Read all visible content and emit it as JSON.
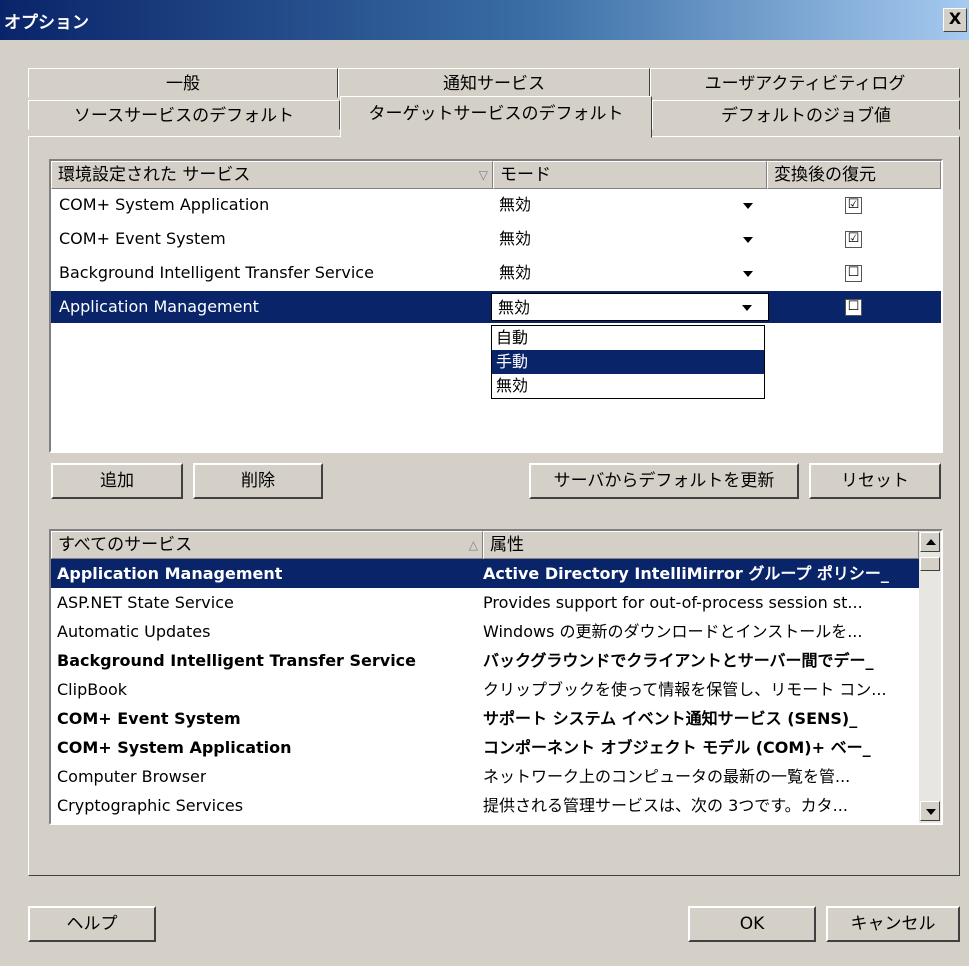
{
  "window": {
    "title": "オプション",
    "close_label": "X"
  },
  "tabs_row1": [
    "一般",
    "通知サービス",
    "ユーザアクティビティログ"
  ],
  "tabs_row2": [
    "ソースサービスのデフォルト",
    "ターゲットサービスのデフォルト",
    "デフォルトのジョブ値"
  ],
  "configured": {
    "headers": {
      "service": "環境設定された サービス",
      "mode": "モード",
      "restore": "変換後の復元"
    },
    "rows": [
      {
        "service": "COM+ System Application",
        "mode": "無効",
        "restore": "☑"
      },
      {
        "service": "COM+ Event System",
        "mode": "無効",
        "restore": "☑"
      },
      {
        "service": "Background Intelligent Transfer Service",
        "mode": "無効",
        "restore": "☐"
      },
      {
        "service": "Application Management",
        "mode": "無効",
        "restore": "☐"
      }
    ],
    "dropdown_options": [
      "自動",
      "手動",
      "無効"
    ],
    "dropdown_selected": "手動"
  },
  "buttons": {
    "add": "追加",
    "delete": "削除",
    "update_from_server": "サーバからデフォルトを更新",
    "reset": "リセット",
    "help": "ヘルプ",
    "ok": "OK",
    "cancel": "キャンセル"
  },
  "all_services": {
    "headers": {
      "service": "すべてのサービス",
      "attr": "属性"
    },
    "rows": [
      {
        "name": "Application Management",
        "attr": "Active Directory IntelliMirror グループ ポリシー_",
        "bold": true
      },
      {
        "name": "ASP.NET State Service",
        "attr": "Provides support for out-of-process session st...",
        "bold": false
      },
      {
        "name": "Automatic Updates",
        "attr": "Windows の更新のダウンロードとインストールを...",
        "bold": false
      },
      {
        "name": "Background Intelligent Transfer Service",
        "attr": "バックグラウンドでクライアントとサーバー間でデー_",
        "bold": true
      },
      {
        "name": "ClipBook",
        "attr": "クリップブックを使って情報を保管し、リモート コン...",
        "bold": false
      },
      {
        "name": "COM+ Event System",
        "attr": "サポート システム イベント通知サービス (SENS)_",
        "bold": true
      },
      {
        "name": "COM+ System Application",
        "attr": "コンポーネント オブジェクト モデル (COM)+ ベー_",
        "bold": true
      },
      {
        "name": "Computer Browser",
        "attr": "ネットワーク上のコンピュータの最新の一覧を管...",
        "bold": false
      },
      {
        "name": "Cryptographic Services",
        "attr": "提供される管理サービスは、次の 3つです。カタ...",
        "bold": false
      }
    ]
  }
}
